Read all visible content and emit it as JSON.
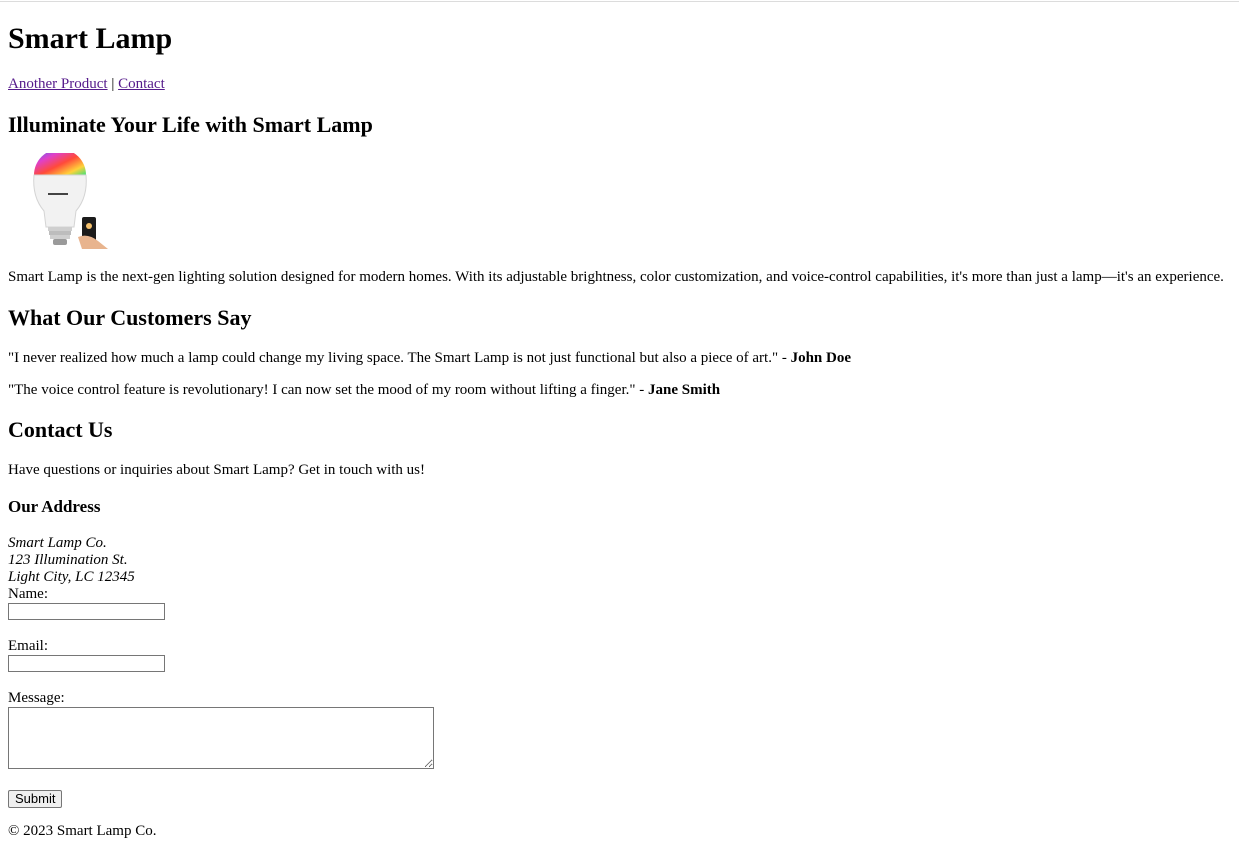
{
  "header": {
    "title": "Smart Lamp",
    "nav": [
      {
        "label": "Another Product"
      },
      {
        "label": "Contact"
      }
    ],
    "nav_separator": " | "
  },
  "product": {
    "heading": "Illuminate Your Life with Smart Lamp",
    "image_icon": "smart-bulb-with-phone-image",
    "description": "Smart Lamp is the next-gen lighting solution designed for modern homes. With its adjustable brightness, color customization, and voice-control capabilities, it's more than just a lamp—it's an experience."
  },
  "testimonials": {
    "heading": "What Our Customers Say",
    "items": [
      {
        "quote": "\"I never realized how much a lamp could change my living space. The Smart Lamp is not just functional but also a piece of art.\" - ",
        "author": "John Doe"
      },
      {
        "quote": "\"The voice control feature is revolutionary! I can now set the mood of my room without lifting a finger.\" - ",
        "author": "Jane Smith"
      }
    ]
  },
  "contact": {
    "heading": "Contact Us",
    "intro": "Have questions or inquiries about Smart Lamp? Get in touch with us!",
    "address_heading": "Our Address",
    "address_lines": [
      "Smart Lamp Co.",
      "123 Illumination St.",
      "Light City, LC 12345"
    ],
    "form": {
      "name_label": "Name:",
      "name_value": "",
      "email_label": "Email:",
      "email_value": "",
      "message_label": "Message:",
      "message_value": "",
      "submit_label": "Submit"
    }
  },
  "footer": {
    "text": "© 2023 Smart Lamp Co."
  },
  "colors": {
    "visited_link": "#551a8b",
    "input_border": "#767676",
    "button_bg": "#efefef"
  }
}
